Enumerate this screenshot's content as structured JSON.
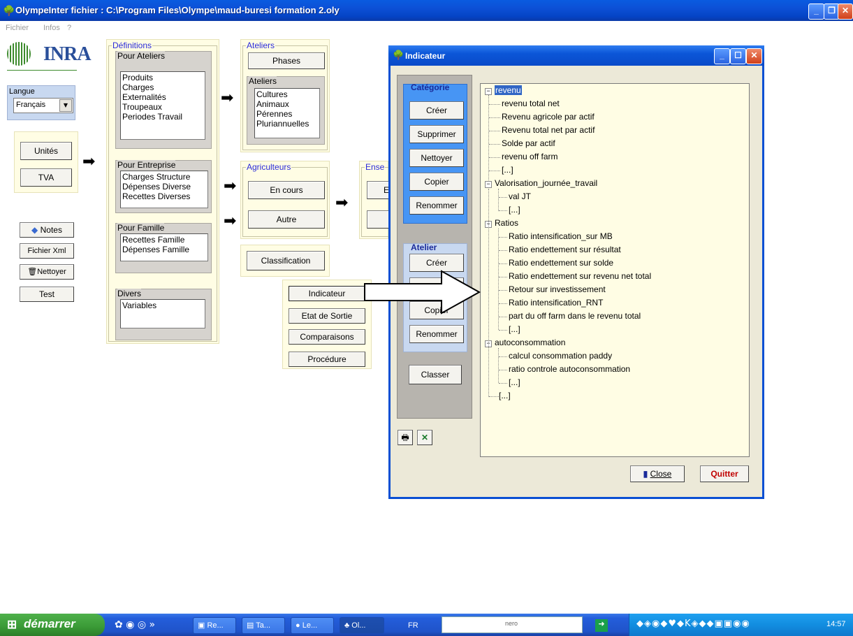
{
  "window": {
    "title": "OlympeInter  fichier : C:\\Program Files\\Olympe\\maud-buresi  formation 2.oly"
  },
  "menu": {
    "fichier": "Fichier",
    "infos": "Infos",
    "help": "?"
  },
  "logo": {
    "text": "INRA"
  },
  "langue": {
    "label": "Langue",
    "value": "Français"
  },
  "left_buttons": {
    "unites": "Unités",
    "tva": "TVA",
    "notes": "Notes",
    "fichierxml": "Fichier Xml",
    "nettoyer": "Nettoyer",
    "test": "Test"
  },
  "definitions": {
    "label": "Définitions",
    "pour_ateliers": {
      "label": "Pour Ateliers",
      "items": [
        "Produits",
        "Charges",
        "Externalités",
        "Troupeaux",
        "Periodes Travail"
      ]
    },
    "pour_entreprise": {
      "label": "Pour Entreprise",
      "items": [
        "Charges Structure",
        "Dépenses Diverse",
        "Recettes Diverses"
      ]
    },
    "pour_famille": {
      "label": "Pour Famille",
      "items": [
        "Recettes Famille",
        "Dépenses Famille"
      ]
    },
    "divers": {
      "label": "Divers",
      "items": [
        "Variables"
      ]
    }
  },
  "ateliers": {
    "label": "Ateliers",
    "phases": "Phases",
    "sublabel": "Ateliers",
    "items": [
      "Cultures",
      "Animaux",
      "Pérennes",
      "Pluriannuelles"
    ]
  },
  "agriculteurs": {
    "label": "Agriculteurs",
    "en_cours": "En cours",
    "autre": "Autre"
  },
  "ensemble": {
    "label": "Ense",
    "btn1": "E"
  },
  "classification": "Classification",
  "outputs": {
    "indicateur": "Indicateur",
    "etat": "Etat de Sortie",
    "comparaisons": "Comparaisons",
    "procedure": "Procédure"
  },
  "dialog": {
    "title": "Indicateur",
    "categorie": {
      "label": "Catégorie",
      "creer": "Créer",
      "supprimer": "Supprimer",
      "nettoyer": "Nettoyer",
      "copier": "Copier",
      "renommer": "Renommer"
    },
    "atelier": {
      "label": "Atelier",
      "creer": "Créer",
      "copier": "Copier",
      "renommer": "Renommer"
    },
    "classer": "Classer",
    "close": "Close",
    "quitter": "Quitter",
    "tree": {
      "n0": "revenu",
      "n0c": [
        "revenu total net",
        "Revenu agricole par actif",
        "Revenu total net par actif",
        "Solde par actif",
        "revenu off farm",
        "[...]"
      ],
      "n1": "Valorisation_journée_travail",
      "n1c": [
        "val JT",
        "[...]"
      ],
      "n2": "Ratios",
      "n2c": [
        "Ratio intensification_sur MB",
        "Ratio endettement sur résultat",
        "Ratio endettement sur solde",
        "Ratio endettement sur revenu net total",
        "Retour sur investissement",
        "Ratio intensification_RNT",
        "part du off farm dans le revenu total",
        "[...]"
      ],
      "n3": "autoconsommation",
      "n3c": [
        "calcul consommation paddy",
        "ratio controle autoconsommation",
        "[...]"
      ],
      "end": "[...]"
    }
  },
  "taskbar": {
    "start": "démarrer",
    "items": [
      "Re...",
      "Ta...",
      "Le...",
      "Ol..."
    ],
    "lang": "FR",
    "search": "nero",
    "clock": "14:57"
  },
  "colors": {
    "panel": "#fffde4",
    "titlebar": "#0a4fd3",
    "group_label": "#2b2bd9",
    "categorie_box": "#4795f4",
    "atelier_box": "#c8d8f0",
    "quitter": "#c00000"
  }
}
